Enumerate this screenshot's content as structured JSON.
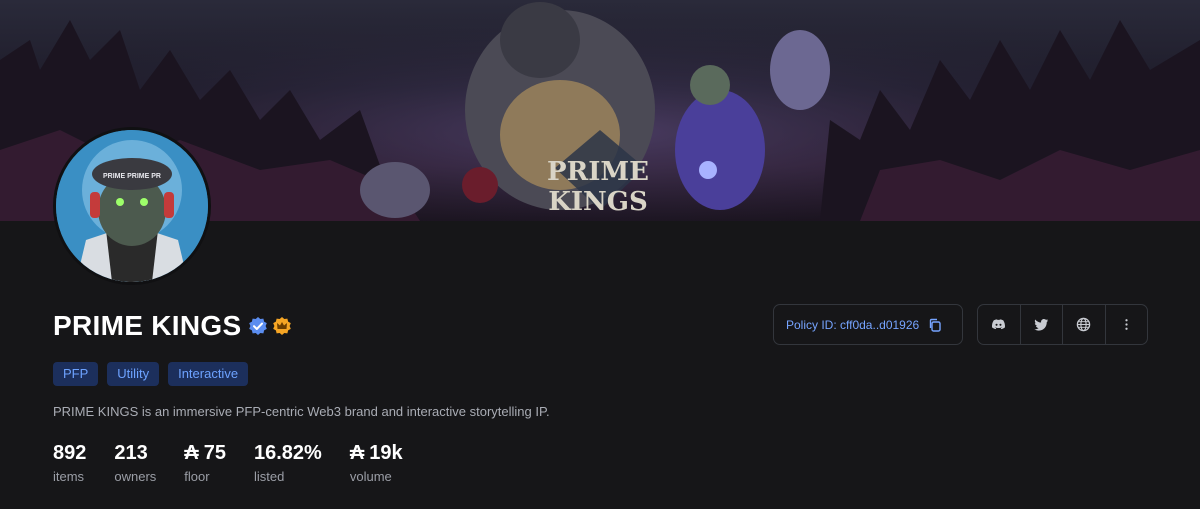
{
  "banner": {
    "logo_line1": "PRIME",
    "logo_line2": "KINGS"
  },
  "avatar": {
    "text": "PRIME PRIME PR"
  },
  "collection": {
    "name": "PRIME KINGS",
    "verified_icon": "verified-badge-icon",
    "crown_icon": "crown-badge-icon",
    "tags": [
      "PFP",
      "Utility",
      "Interactive"
    ],
    "description": "PRIME KINGS is an immersive PFP-centric Web3 brand and interactive storytelling IP."
  },
  "stats": {
    "items": {
      "value": "892",
      "label": "items"
    },
    "owners": {
      "value": "213",
      "label": "owners"
    },
    "floor": {
      "currency": "₳",
      "value": "75",
      "label": "floor"
    },
    "listed": {
      "value": "16.82%",
      "label": "listed"
    },
    "volume": {
      "currency": "₳",
      "value": "19k",
      "label": "volume"
    }
  },
  "policy": {
    "label": "Policy ID: cff0da..d01926",
    "icon": "copy-icon"
  },
  "socials": [
    "discord-icon",
    "twitter-icon",
    "globe-icon",
    "more-icon"
  ],
  "colors": {
    "accent": "#76a4ff",
    "tag_bg": "#1c2f5c",
    "verified": "#5b8def",
    "crown": "#f5a524"
  }
}
